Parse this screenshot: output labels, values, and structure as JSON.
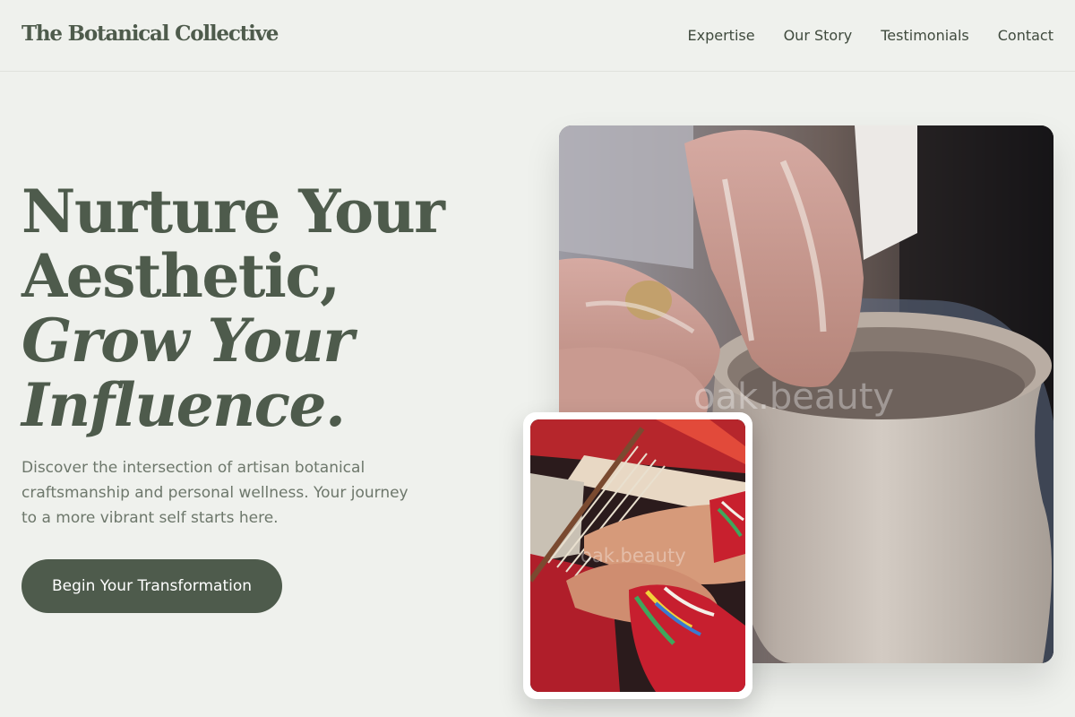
{
  "brand": {
    "name": "The Botanical Collective"
  },
  "nav": {
    "items": [
      {
        "label": "Expertise"
      },
      {
        "label": "Our Story"
      },
      {
        "label": "Testimonials"
      },
      {
        "label": "Contact"
      }
    ]
  },
  "hero": {
    "headline_line1": "Nurture Your",
    "headline_line2": "Aesthetic,",
    "headline_line3": "Grow Your",
    "headline_line4": "Influence.",
    "description": "Discover the intersection of artisan botanical craftsmanship and personal wellness. Your journey to a more vibrant self starts here.",
    "cta_label": "Begin Your Transformation"
  },
  "images": {
    "main_watermark": "oak.beauty",
    "small_watermark": "oak.beauty"
  },
  "colors": {
    "background": "#eff1ed",
    "primary": "#4e5b4c",
    "text_muted": "#6d776b"
  }
}
